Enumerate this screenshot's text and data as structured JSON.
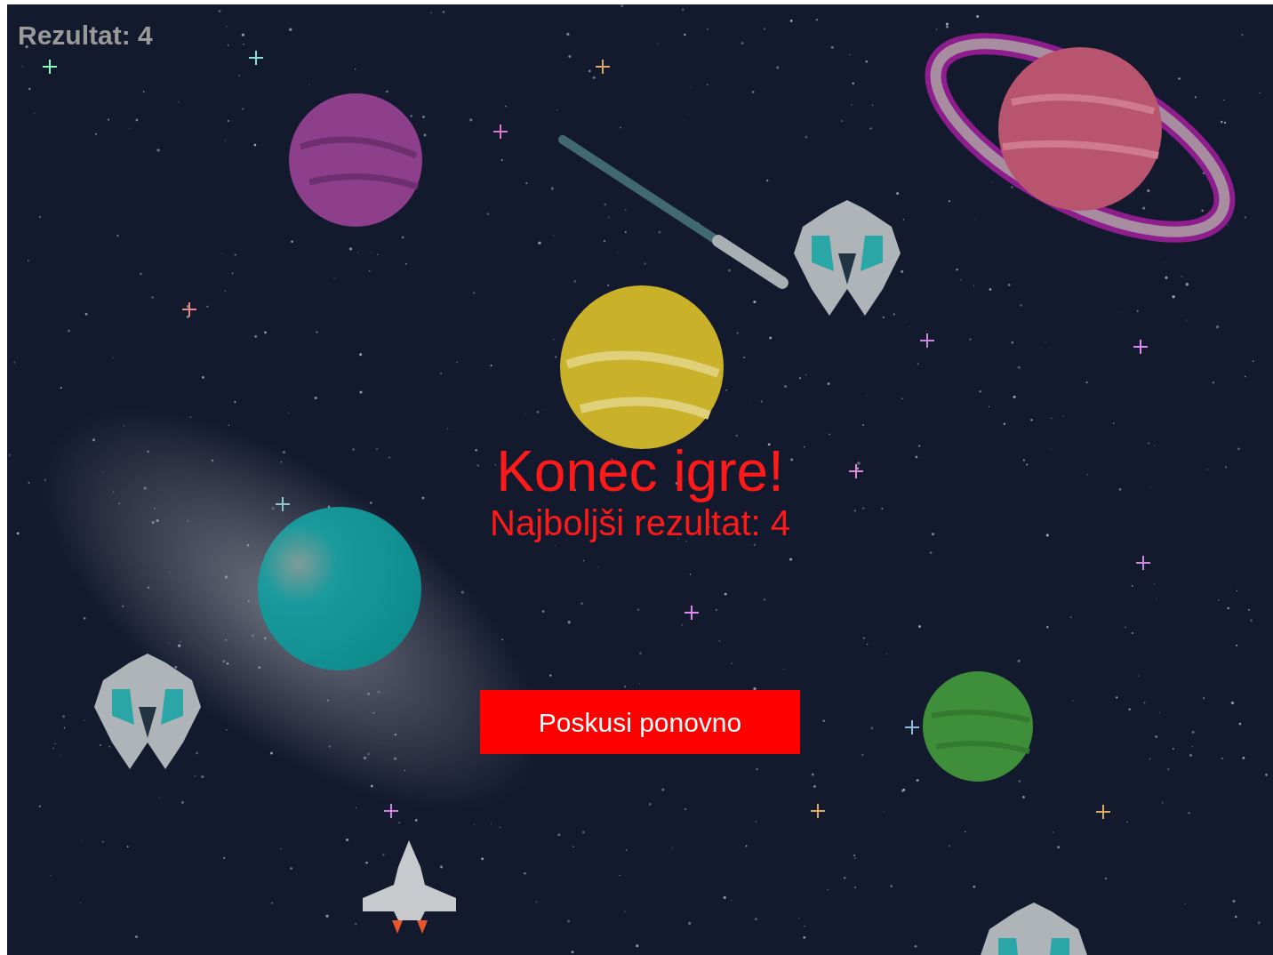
{
  "score_label": "Rezultat: 4",
  "game_over": {
    "title": "Konec igre!",
    "best_score": "Najboljši rezultat: 4"
  },
  "retry_button": {
    "label": "Poskusi ponovno"
  }
}
